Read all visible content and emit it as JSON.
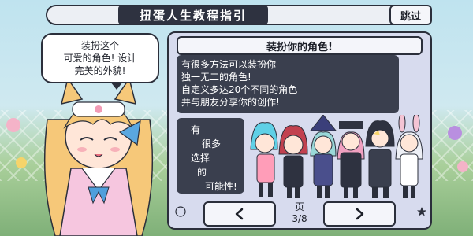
{
  "header": {
    "title": "扭蛋人生教程指引",
    "skip_label": "跳过"
  },
  "guide": {
    "speech_lines": [
      "装扮这个",
      "可爱的角色! 设计",
      "完美的外貌!"
    ]
  },
  "panel": {
    "title": "装扮你的角色!",
    "description_lines": [
      "有很多方法可以装扮你",
      "独一无二的角色!",
      "自定义多达20个不同的角色",
      "并与朋友分享你的创作!"
    ],
    "possibility_lines": [
      "有",
      "很多",
      "选择",
      "的",
      "可能性!"
    ]
  },
  "pagination": {
    "page_word": "页",
    "page_value": "3/8",
    "prev_icon": "chevron-left-icon",
    "next_icon": "chevron-right-icon"
  },
  "colors": {
    "panel_bg": "#d7dbee",
    "dark_box": "#3a3f4e",
    "outline": "#2b2f3b"
  }
}
